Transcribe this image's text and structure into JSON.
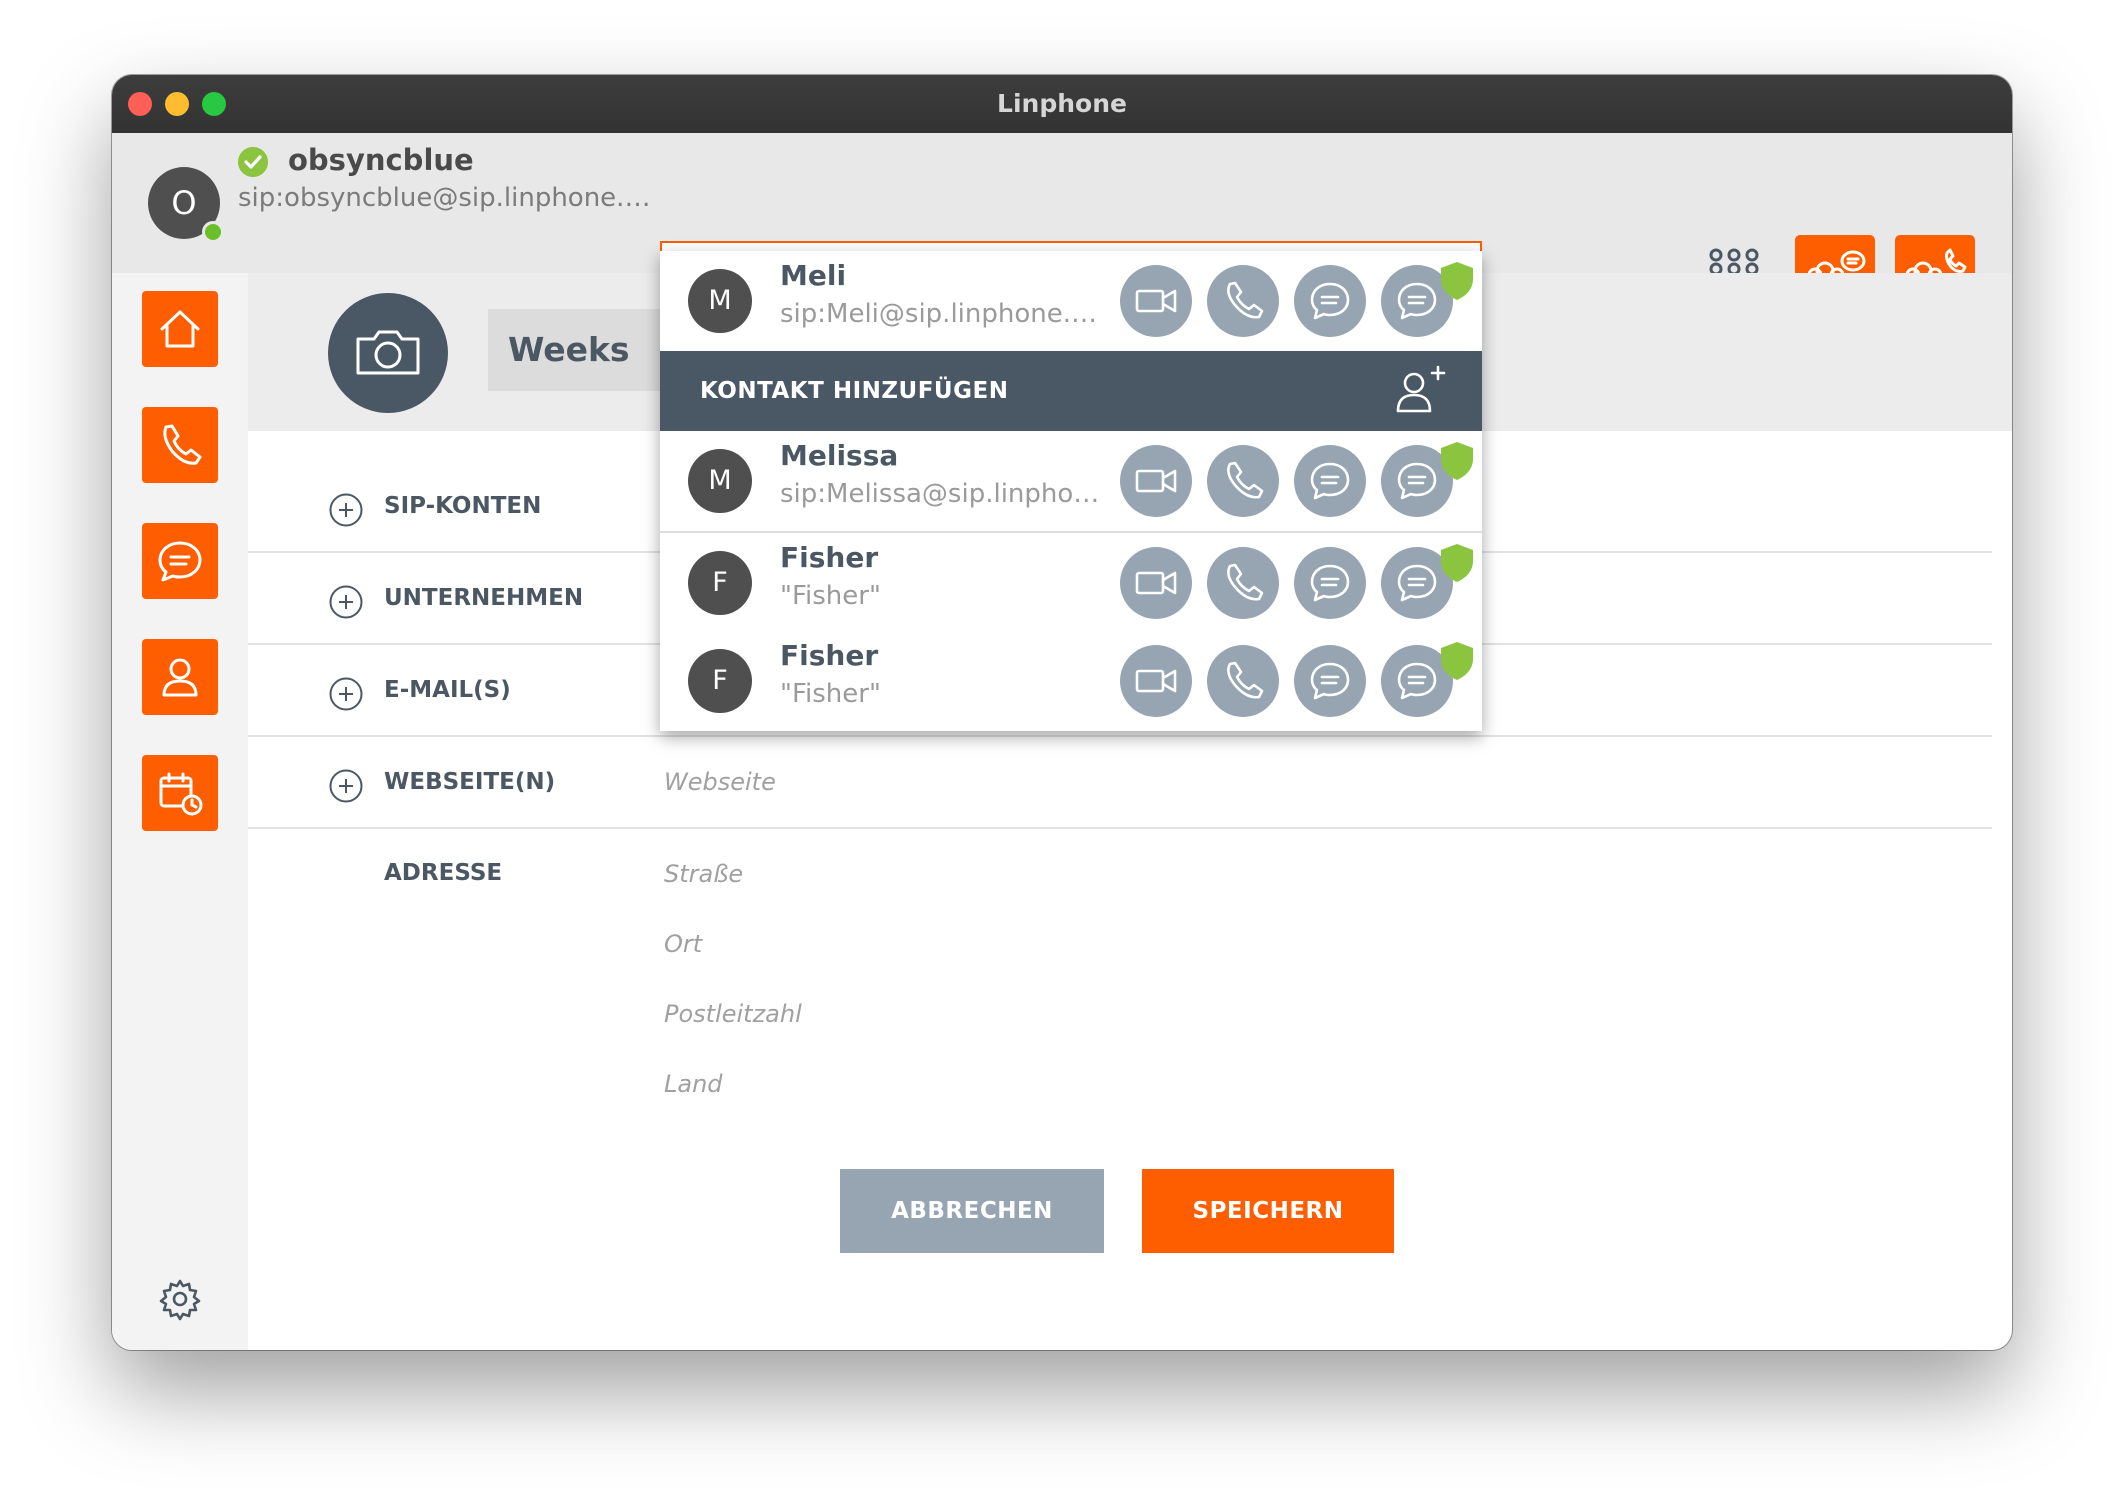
{
  "window": {
    "title": "Linphone"
  },
  "account": {
    "initial": "O",
    "username": "obsyncblue",
    "address": "sip:obsyncblue@sip.linphone.o..."
  },
  "search": {
    "value": "Meli",
    "placeholder": ""
  },
  "results": [
    {
      "initial": "M",
      "name": "Meli",
      "address": "sip:Meli@sip.linphone.org"
    },
    {
      "initial": "M",
      "name": "Melissa",
      "address": "sip:Melissa@sip.linphone...."
    },
    {
      "initial": "F",
      "name": "Fisher",
      "address": "\"Fisher\""
    },
    {
      "initial": "F",
      "name": "Fisher",
      "address": "\"Fisher\""
    }
  ],
  "add_contact_label": "KONTAKT HINZUFÜGEN",
  "contact_form": {
    "name_value": "Weeks",
    "sections": {
      "sip": "SIP-KONTEN",
      "company": "UNTERNEHMEN",
      "email": "E-MAIL(S)",
      "website": "WEBSEITE(N)",
      "address": "ADRESSE"
    },
    "placeholders": {
      "website": "Webseite",
      "street": "Straße",
      "city": "Ort",
      "postal": "Postleitzahl",
      "country": "Land"
    }
  },
  "buttons": {
    "cancel": "ABBRECHEN",
    "save": "SPEICHERN"
  },
  "colors": {
    "accent": "#fe5e00",
    "dark_slate": "#4a5866",
    "action_grey": "#96a5b1",
    "online_green": "#6abf2b",
    "secure_green": "#8bc53f"
  },
  "icons": {
    "nav": [
      "home-icon",
      "phone-icon",
      "chat-icon",
      "contact-icon",
      "calendar-icon"
    ],
    "header": [
      "dialpad-icon",
      "group-chat-icon",
      "conference-call-icon"
    ],
    "result_actions": [
      "video-call-icon",
      "phone-icon",
      "chat-icon",
      "secure-chat-icon"
    ]
  }
}
